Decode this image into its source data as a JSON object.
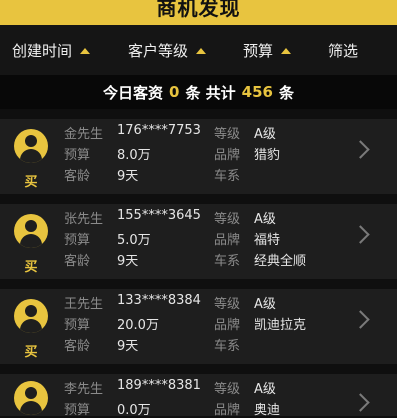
{
  "header": {
    "title": "商机发现"
  },
  "filters": [
    {
      "label": "创建时间"
    },
    {
      "label": "客户等级"
    },
    {
      "label": "预算"
    },
    {
      "label": "筛选"
    }
  ],
  "summary": {
    "prefix": "今日客资",
    "today_count": "0",
    "mid": "条 共计",
    "total_count": "456",
    "suffix": "条"
  },
  "labels": {
    "budget": "预算",
    "age": "客龄",
    "level": "等级",
    "brand": "品牌",
    "series": "车系",
    "buy": "买"
  },
  "leads": [
    {
      "name": "金先生",
      "phone": "176****7753",
      "level": "A级",
      "budget": "8.0万",
      "brand": "猎豹",
      "age": "9天",
      "series": ""
    },
    {
      "name": "张先生",
      "phone": "155****3645",
      "level": "A级",
      "budget": "5.0万",
      "brand": "福特",
      "age": "9天",
      "series": "经典全顺"
    },
    {
      "name": "王先生",
      "phone": "133****8384",
      "level": "A级",
      "budget": "20.0万",
      "brand": "凯迪拉克",
      "age": "9天",
      "series": ""
    },
    {
      "name": "李先生",
      "phone": "189****8381",
      "level": "A级",
      "budget": "0.0万",
      "brand": "奥迪",
      "age": "",
      "series": ""
    }
  ],
  "colors": {
    "accent": "#e8c43f",
    "background": "#0f0f0f",
    "card": "#1e1e1e"
  }
}
